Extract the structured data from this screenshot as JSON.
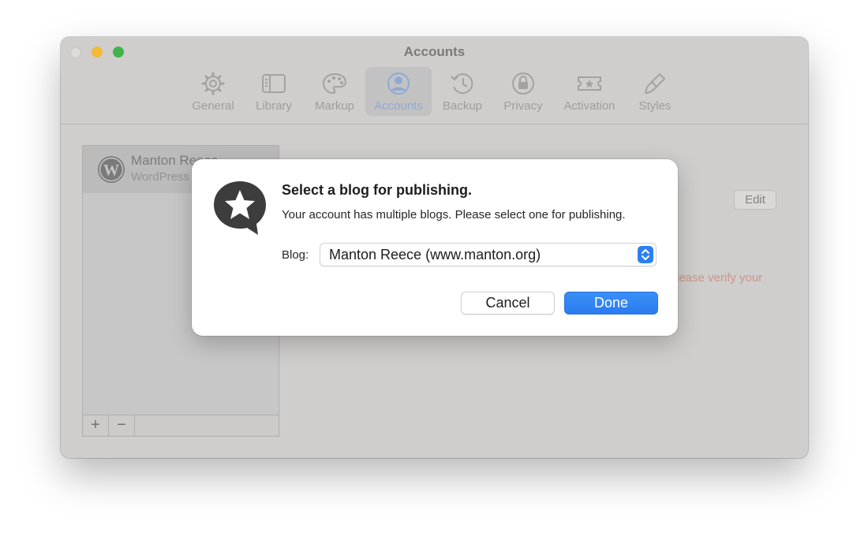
{
  "window": {
    "title": "Accounts"
  },
  "toolbar": {
    "items": [
      {
        "label": "General",
        "icon": "gear-icon"
      },
      {
        "label": "Library",
        "icon": "library-icon"
      },
      {
        "label": "Markup",
        "icon": "palette-icon"
      },
      {
        "label": "Accounts",
        "icon": "person-circle-icon",
        "selected": true
      },
      {
        "label": "Backup",
        "icon": "clock-history-icon"
      },
      {
        "label": "Privacy",
        "icon": "lock-icon"
      },
      {
        "label": "Activation",
        "icon": "ticket-icon"
      },
      {
        "label": "Styles",
        "icon": "paintbrush-icon"
      }
    ]
  },
  "sidebar": {
    "account": {
      "name": "Manton Reece",
      "service": "WordPress",
      "icon": "wordpress-icon"
    },
    "add_label": "+",
    "remove_label": "−"
  },
  "detail": {
    "edit_label": "Edit",
    "verify_text": "lease verify your"
  },
  "dialog": {
    "title": "Select a blog for publishing.",
    "message": "Your account has multiple blogs. Please select one for publishing.",
    "blog_label": "Blog:",
    "blog_selected": "Manton Reece (www.manton.org)",
    "cancel_label": "Cancel",
    "done_label": "Done",
    "icon": "star-speech-bubble-icon"
  },
  "colors": {
    "accent": "#2d7ff1",
    "traffic_min": "#f1ba38",
    "traffic_max": "#3fb44b"
  }
}
